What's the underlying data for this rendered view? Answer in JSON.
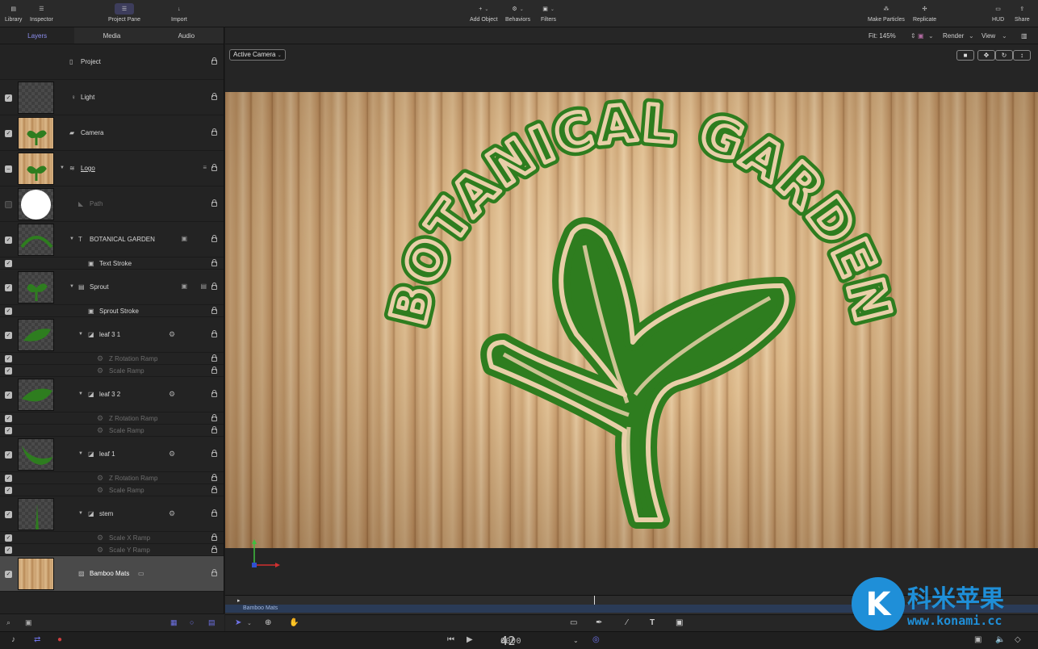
{
  "toolbar": {
    "library": "Library",
    "inspector": "Inspector",
    "project_pane": "Project Pane",
    "import": "Import",
    "add_object": "Add Object",
    "behaviors": "Behaviors",
    "filters": "Filters",
    "make_particles": "Make Particles",
    "replicate": "Replicate",
    "hud": "HUD",
    "share": "Share"
  },
  "left_tabs": [
    "Layers",
    "Media",
    "Audio"
  ],
  "layers": {
    "project": "Project",
    "light": "Light",
    "camera": "Camera",
    "logo": "Logo",
    "path": "Path",
    "botanical_garden": "BOTANICAL GARDEN",
    "text_stroke": "Text Stroke",
    "sprout": "Sprout",
    "sprout_stroke": "Sprout Stroke",
    "leaf31": "leaf 3 1",
    "leaf31_zrot": "Z Rotation Ramp",
    "leaf31_scale": "Scale Ramp",
    "leaf32": "leaf 3 2",
    "leaf32_zrot": "Z Rotation Ramp",
    "leaf32_scale": "Scale Ramp",
    "leaf1": "leaf 1",
    "leaf1_zrot": "Z Rotation Ramp",
    "leaf1_scale": "Scale Ramp",
    "stem": "stem",
    "stem_scalex": "Scale X Ramp",
    "stem_scaley": "Scale Y Ramp",
    "bamboo": "Bamboo Mats"
  },
  "viewer": {
    "fit": "Fit: 145%",
    "render": "Render",
    "view": "View",
    "active_camera": "Active Camera",
    "canvas_title": "BOTANICAL GARDEN"
  },
  "timeline": {
    "clip_label": "Bamboo Mats"
  },
  "transport": {
    "timecode_dim": "0000",
    "timecode_bright": "42"
  },
  "watermark": {
    "brand": "科米苹果",
    "site": "www.konami.cc"
  },
  "colors": {
    "accent": "#8d8ff0",
    "logo_green": "#2e7d1f",
    "timeline_clip": "#2a3b57"
  }
}
